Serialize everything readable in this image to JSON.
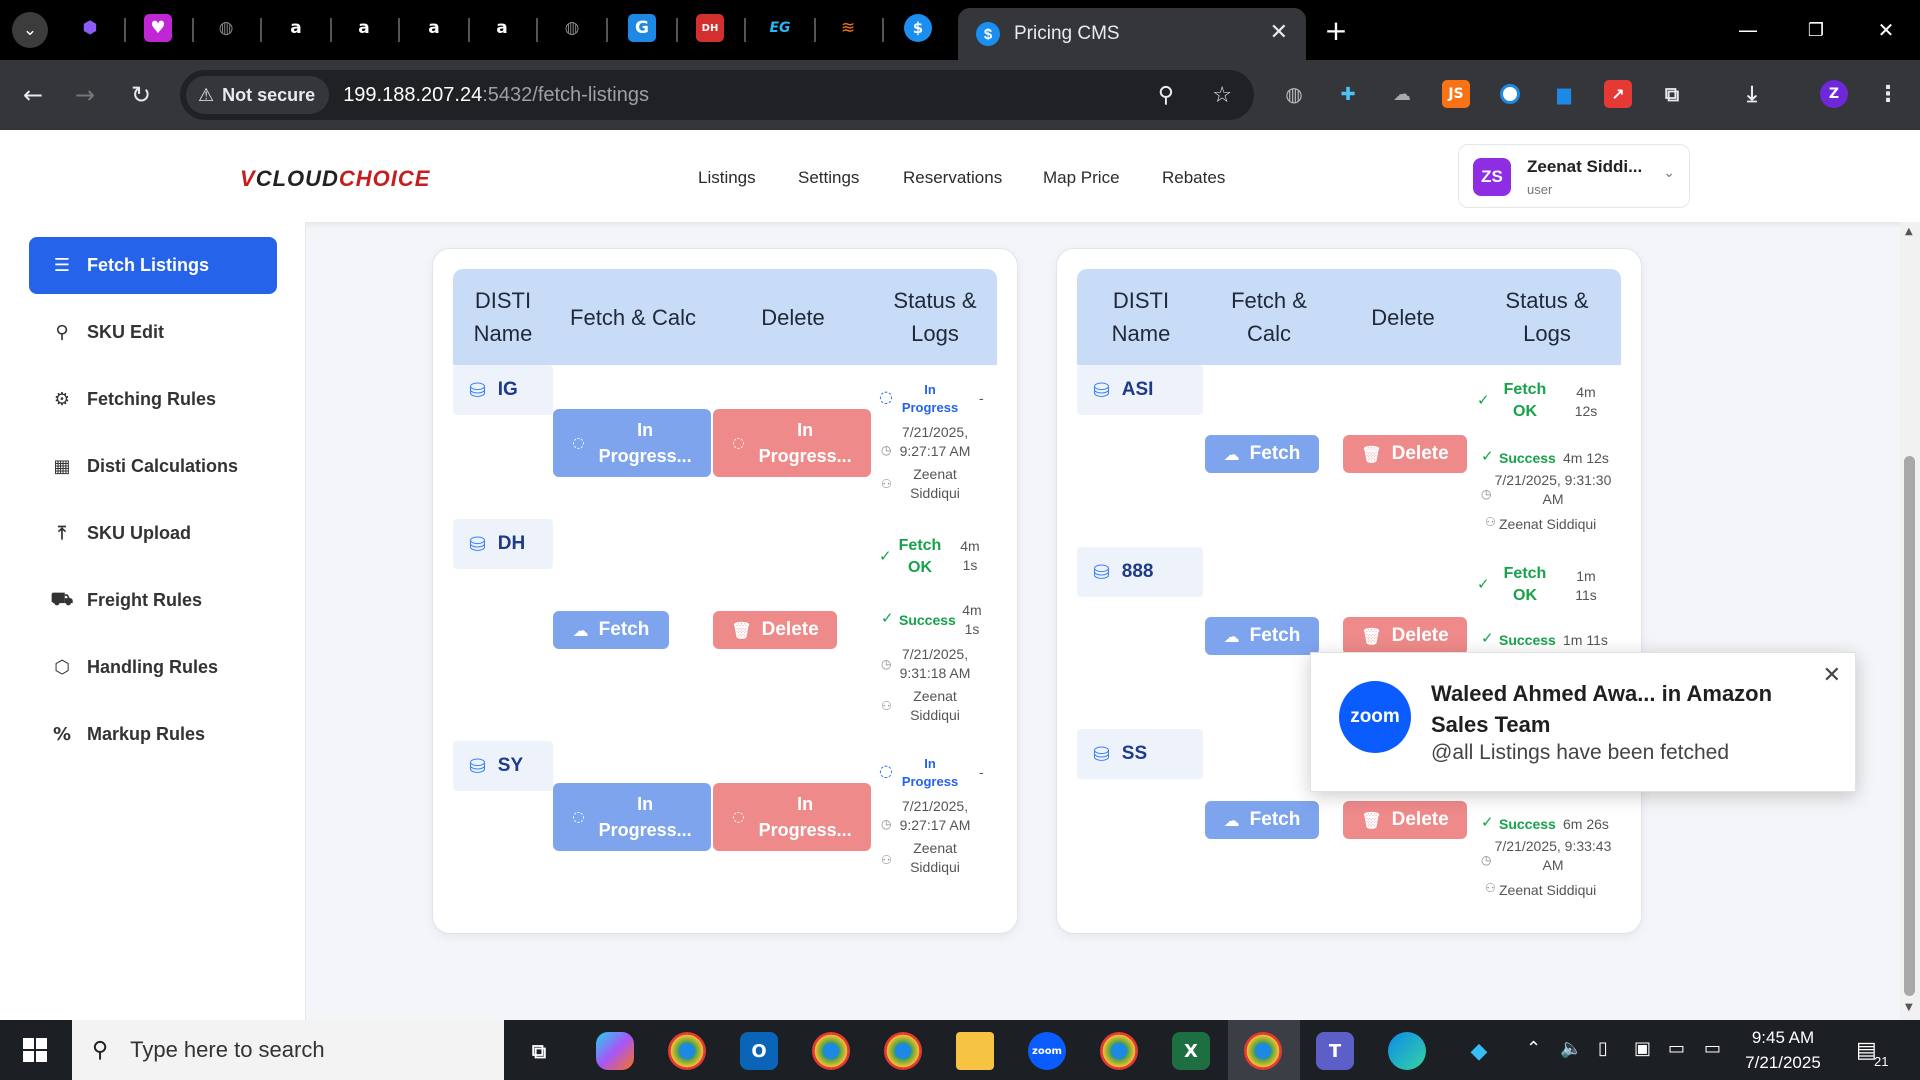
{
  "browser": {
    "active_tab_title": "Pricing CMS",
    "new_tab": "+",
    "not_secure": "Not secure",
    "url_host": "199.188.207.24",
    "url_path": ":5432/fetch-listings",
    "profile_initial": "Z",
    "other_tabs": [
      "cube-icon",
      "heart-app-icon",
      "globe-icon",
      "amazon-icon",
      "amazon-icon",
      "amazon-icon",
      "amazon-icon",
      "globe-icon",
      "g-icon",
      "dh-icon",
      "eg-icon",
      "stack-icon",
      "dollar-icon"
    ],
    "extensions": [
      "globe-ext-icon",
      "puzzle-plus-icon",
      "cloud-icon",
      "js-icon",
      "circle-icon",
      "chart-icon",
      "arrow-icon",
      "extensions-icon"
    ]
  },
  "header": {
    "logo_v": "V",
    "logo_cloud": "CLOUD",
    "logo_choice": "CHOICE",
    "nav": [
      "Listings",
      "Settings",
      "Reservations",
      "Map Price",
      "Rebates"
    ],
    "user_initials": "ZS",
    "user_name": "Zeenat Siddi...",
    "user_role": "user"
  },
  "sidebar": {
    "items": [
      {
        "label": "Fetch Listings",
        "icon": "list-icon"
      },
      {
        "label": "SKU Edit",
        "icon": "search-icon"
      },
      {
        "label": "Fetching Rules",
        "icon": "gear-icon"
      },
      {
        "label": "Disti Calculations",
        "icon": "calculator-icon"
      },
      {
        "label": "SKU Upload",
        "icon": "upload-icon"
      },
      {
        "label": "Freight Rules",
        "icon": "truck-icon"
      },
      {
        "label": "Handling Rules",
        "icon": "package-icon"
      },
      {
        "label": "Markup Rules",
        "icon": "percent-icon"
      }
    ]
  },
  "left_table": {
    "headers": {
      "disti": "DISTI\nName",
      "fetch": "Fetch & Calc",
      "delete": "Delete",
      "status": "Status &\nLogs"
    },
    "rows": [
      {
        "name": "IG",
        "fetch_btn": "In\nProgress...",
        "delete_btn": "In\nProgress...",
        "status": "In\nProgress",
        "dash": "-",
        "time": "7/21/2025,\n9:27:17 AM",
        "user": "Zeenat\nSiddiqui"
      },
      {
        "name": "DH",
        "fetch_btn": "Fetch",
        "delete_btn": "Delete",
        "fetch_status": "Fetch\nOK",
        "fetch_age": "4m\n1s",
        "result": "Success",
        "result_age": "4m\n1s",
        "time": "7/21/2025,\n9:31:18 AM",
        "user": "Zeenat\nSiddiqui"
      },
      {
        "name": "SY",
        "fetch_btn": "In\nProgress...",
        "delete_btn": "In\nProgress...",
        "status": "In\nProgress",
        "dash": "-",
        "time": "7/21/2025,\n9:27:17 AM",
        "user": "Zeenat\nSiddiqui"
      }
    ]
  },
  "right_table": {
    "headers": {
      "disti": "DISTI\nName",
      "fetch": "Fetch &\nCalc",
      "delete": "Delete",
      "status": "Status &\nLogs"
    },
    "rows": [
      {
        "name": "ASI",
        "fetch_btn": "Fetch",
        "delete_btn": "Delete",
        "fetch_status": "Fetch\nOK",
        "fetch_age": "4m\n12s",
        "result": "Success",
        "result_age": "4m 12s",
        "time": "7/21/2025, 9:31:30\nAM",
        "user": "Zeenat Siddiqui"
      },
      {
        "name": "888",
        "fetch_btn": "Fetch",
        "delete_btn": "Delete",
        "fetch_status": "Fetch\nOK",
        "fetch_age": "1m\n11s",
        "result": "Success",
        "result_age": "1m 11s"
      },
      {
        "name": "SS",
        "fetch_btn": "Fetch",
        "delete_btn": "Delete",
        "result": "Success",
        "result_age": "6m 26s",
        "time": "7/21/2025, 9:33:43\nAM",
        "user": "Zeenat Siddiqui"
      }
    ]
  },
  "toast": {
    "app": "zoom",
    "title": "Waleed Ahmed Awa... in Amazon\nSales Team",
    "message": "@all Listings have been fetched"
  },
  "taskbar": {
    "search_placeholder": "Type here to search",
    "time": "9:45 AM",
    "date": "7/21/2025",
    "notification_count": "21",
    "apps": [
      "task-view-icon",
      "copilot-icon",
      "chrome-profile-icon",
      "outlook-icon",
      "chrome-profile-icon",
      "chrome-profile-icon",
      "file-explorer-icon",
      "zoom-icon",
      "chrome-icon",
      "excel-icon",
      "chrome-active-icon",
      "teams-icon",
      "edge-icon",
      "vscode-icon"
    ]
  },
  "colors": {
    "primary": "#2563eb",
    "fetch_button": "#7ea4ee",
    "delete_button": "#ef8a8a",
    "success": "#16a34a",
    "header_row": "#c9dcf7"
  }
}
